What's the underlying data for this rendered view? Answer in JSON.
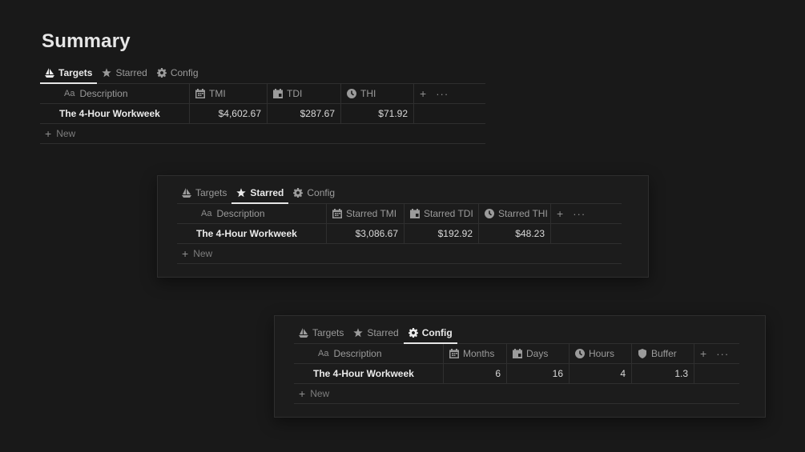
{
  "page": {
    "title": "Summary"
  },
  "tabs": {
    "targets": "Targets",
    "starred": "Starred",
    "config": "Config"
  },
  "desc_prefix": "Aa",
  "desc_header": "Description",
  "new_label": "New",
  "dots": "···",
  "row_name": "The 4-Hour Workweek",
  "targets": {
    "headers": {
      "tmi": "TMI",
      "tdi": "TDI",
      "thi": "THI"
    },
    "values": {
      "tmi": "$4,602.67",
      "tdi": "$287.67",
      "thi": "$71.92"
    }
  },
  "starred": {
    "headers": {
      "tmi": "Starred TMI",
      "tdi": "Starred TDI",
      "thi": "Starred THI"
    },
    "values": {
      "tmi": "$3,086.67",
      "tdi": "$192.92",
      "thi": "$48.23"
    }
  },
  "config": {
    "headers": {
      "months": "Months",
      "days": "Days",
      "hours": "Hours",
      "buffer": "Buffer"
    },
    "values": {
      "months": "6",
      "days": "16",
      "hours": "4",
      "buffer": "1.3"
    }
  },
  "icons": {
    "targets": "sailboat-icon",
    "starred": "star-icon",
    "config": "gear-icon",
    "tmi": "calendar-icon",
    "tdi": "calendar-day-icon",
    "thi": "clock-icon",
    "buffer": "shield-icon"
  }
}
